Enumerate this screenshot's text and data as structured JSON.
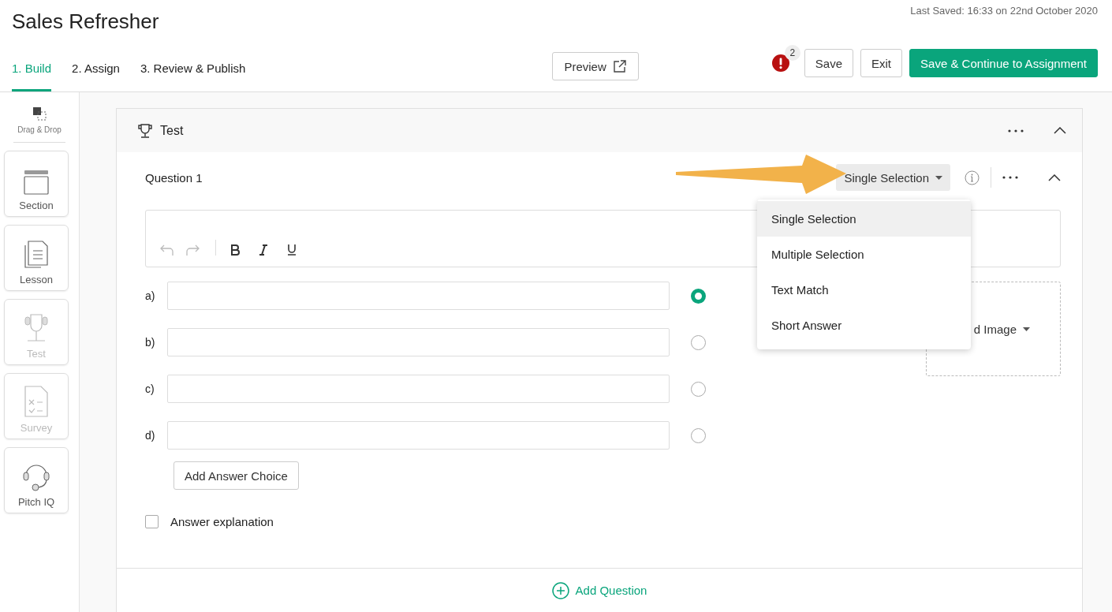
{
  "title": "Sales Refresher",
  "last_saved": "Last Saved: 16:33 on 22nd October 2020",
  "tabs": [
    {
      "label": "1. Build",
      "selected": true
    },
    {
      "label": "2. Assign",
      "selected": false
    },
    {
      "label": "3. Review & Publish",
      "selected": false
    }
  ],
  "preview_button": "Preview",
  "alert_count": "2",
  "actions": {
    "save": "Save",
    "exit": "Exit",
    "continue": "Save & Continue to Assignment"
  },
  "sidebar": {
    "header": "Drag & Drop",
    "items": [
      {
        "kind": "section",
        "label": "Section",
        "disabled": false
      },
      {
        "kind": "lesson",
        "label": "Lesson",
        "disabled": false
      },
      {
        "kind": "test",
        "label": "Test",
        "disabled": true
      },
      {
        "kind": "survey",
        "label": "Survey",
        "disabled": true
      },
      {
        "kind": "pitch",
        "label": "Pitch IQ",
        "disabled": false
      }
    ]
  },
  "card": {
    "title": "Test",
    "question": {
      "label": "Question 1",
      "type": "Single Selection",
      "type_menu": [
        {
          "label": "Single Selection",
          "selected": true
        },
        {
          "label": "Multiple Selection",
          "selected": false
        },
        {
          "label": "Text Match",
          "selected": false
        },
        {
          "label": "Short Answer",
          "selected": false
        }
      ],
      "answers": [
        {
          "label": "a)",
          "selected": true
        },
        {
          "label": "b)",
          "selected": false
        },
        {
          "label": "c)",
          "selected": false
        },
        {
          "label": "d)",
          "selected": false
        }
      ],
      "add_choice": "Add Answer Choice",
      "image_button": "d Image",
      "explanation": {
        "label": "Answer explanation",
        "checked": false
      }
    },
    "add_question": "Add Question"
  }
}
